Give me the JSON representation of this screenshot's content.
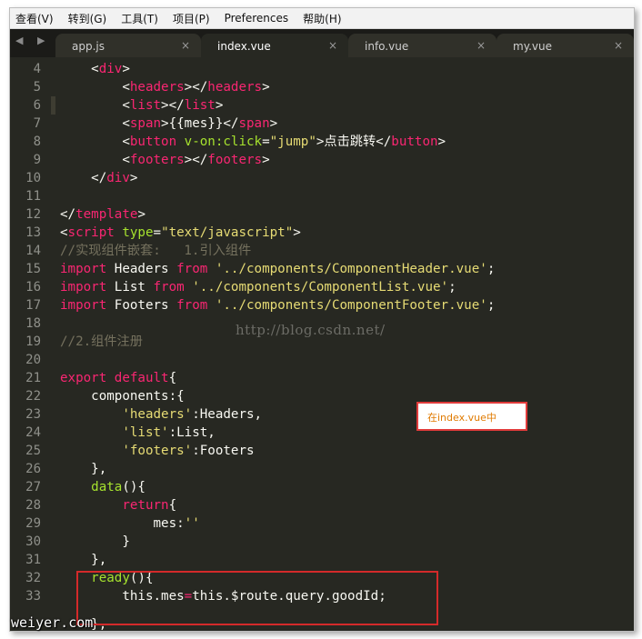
{
  "menu": [
    "查看(V)",
    "转到(G)",
    "工具(T)",
    "项目(P)",
    "Preferences",
    "帮助(H)"
  ],
  "nav_arrows": "◀ ▶",
  "tabs": [
    {
      "label": "app.js",
      "close": "×"
    },
    {
      "label": "index.vue",
      "close": "×"
    },
    {
      "label": "info.vue",
      "close": "×"
    },
    {
      "label": "my.vue",
      "close": "×"
    }
  ],
  "line_numbers": [
    "4",
    "5",
    "6",
    "7",
    "8",
    "9",
    "10",
    "11",
    "12",
    "13",
    "14",
    "15",
    "16",
    "17",
    "18",
    "19",
    "20",
    "21",
    "22",
    "23",
    "24",
    "25",
    "26",
    "27",
    "28",
    "29",
    "30",
    "31",
    "32",
    "33"
  ],
  "code": [
    [
      [
        "pl",
        "    <"
      ],
      [
        "tag",
        "div"
      ],
      [
        "pl",
        ">"
      ]
    ],
    [
      [
        "pl",
        "        <"
      ],
      [
        "tag",
        "headers"
      ],
      [
        "pl",
        "></"
      ],
      [
        "tag",
        "headers"
      ],
      [
        "pl",
        ">"
      ]
    ],
    [
      [
        "pl",
        "        <"
      ],
      [
        "tag",
        "list"
      ],
      [
        "pl",
        "></"
      ],
      [
        "tag",
        "list"
      ],
      [
        "pl",
        ">"
      ]
    ],
    [
      [
        "pl",
        "        <"
      ],
      [
        "tag",
        "span"
      ],
      [
        "pl",
        ">{{mes}}</"
      ],
      [
        "tag",
        "span"
      ],
      [
        "pl",
        ">"
      ]
    ],
    [
      [
        "pl",
        "        <"
      ],
      [
        "tag",
        "button"
      ],
      [
        "pl",
        " "
      ],
      [
        "attr",
        "v-on:click"
      ],
      [
        "pl",
        "="
      ],
      [
        "str",
        "\"jump\""
      ],
      [
        "pl",
        ">点击跳转</"
      ],
      [
        "tag",
        "button"
      ],
      [
        "pl",
        ">"
      ]
    ],
    [
      [
        "pl",
        "        <"
      ],
      [
        "tag",
        "footers"
      ],
      [
        "pl",
        "></"
      ],
      [
        "tag",
        "footers"
      ],
      [
        "pl",
        ">"
      ]
    ],
    [
      [
        "pl",
        "    </"
      ],
      [
        "tag",
        "div"
      ],
      [
        "pl",
        ">"
      ]
    ],
    [
      [
        "pl",
        ""
      ]
    ],
    [
      [
        "pl",
        "</"
      ],
      [
        "tag",
        "template"
      ],
      [
        "pl",
        ">"
      ]
    ],
    [
      [
        "pl",
        "<"
      ],
      [
        "tag",
        "script"
      ],
      [
        "pl",
        " "
      ],
      [
        "attr",
        "type"
      ],
      [
        "pl",
        "="
      ],
      [
        "str",
        "\"text/javascript\""
      ],
      [
        "pl",
        ">"
      ]
    ],
    [
      [
        "com",
        "//实现组件嵌套:   1.引入组件"
      ]
    ],
    [
      [
        "kw",
        "import"
      ],
      [
        "pl",
        " Headers "
      ],
      [
        "kw",
        "from"
      ],
      [
        "pl",
        " "
      ],
      [
        "str",
        "'../components/ComponentHeader.vue'"
      ],
      [
        "pl",
        ";"
      ]
    ],
    [
      [
        "kw",
        "import"
      ],
      [
        "pl",
        " List "
      ],
      [
        "kw",
        "from"
      ],
      [
        "pl",
        " "
      ],
      [
        "str",
        "'../components/ComponentList.vue'"
      ],
      [
        "pl",
        ";"
      ]
    ],
    [
      [
        "kw",
        "import"
      ],
      [
        "pl",
        " Footers "
      ],
      [
        "kw",
        "from"
      ],
      [
        "pl",
        " "
      ],
      [
        "str",
        "'../components/ComponentFooter.vue'"
      ],
      [
        "pl",
        ";"
      ]
    ],
    [
      [
        "pl",
        ""
      ]
    ],
    [
      [
        "com",
        "//2.组件注册"
      ]
    ],
    [
      [
        "pl",
        ""
      ]
    ],
    [
      [
        "kw",
        "export"
      ],
      [
        "pl",
        " "
      ],
      [
        "kw",
        "default"
      ],
      [
        "pl",
        "{"
      ]
    ],
    [
      [
        "pl",
        "    components:{"
      ]
    ],
    [
      [
        "pl",
        "        "
      ],
      [
        "str",
        "'headers'"
      ],
      [
        "pl",
        ":Headers,"
      ]
    ],
    [
      [
        "pl",
        "        "
      ],
      [
        "str",
        "'list'"
      ],
      [
        "pl",
        ":List,"
      ]
    ],
    [
      [
        "pl",
        "        "
      ],
      [
        "str",
        "'footers'"
      ],
      [
        "pl",
        ":Footers"
      ]
    ],
    [
      [
        "pl",
        "    },"
      ]
    ],
    [
      [
        "pl",
        "    "
      ],
      [
        "fn",
        "data"
      ],
      [
        "pl",
        "(){"
      ]
    ],
    [
      [
        "pl",
        "        "
      ],
      [
        "kw",
        "return"
      ],
      [
        "pl",
        "{"
      ]
    ],
    [
      [
        "pl",
        "            mes:"
      ],
      [
        "str",
        "''"
      ]
    ],
    [
      [
        "pl",
        "        }"
      ]
    ],
    [
      [
        "pl",
        "    },"
      ]
    ],
    [
      [
        "pl",
        "    "
      ],
      [
        "fn",
        "ready"
      ],
      [
        "pl",
        "(){"
      ]
    ],
    [
      [
        "pl",
        "        this.mes"
      ],
      [
        "kw",
        "="
      ],
      [
        "pl",
        "this.$route.query.goodId;"
      ]
    ]
  ],
  "partial_line": "    },",
  "watermark": "http://blog.csdn.net/",
  "note": "在index.vue中",
  "site_mark": "weiyer.com"
}
